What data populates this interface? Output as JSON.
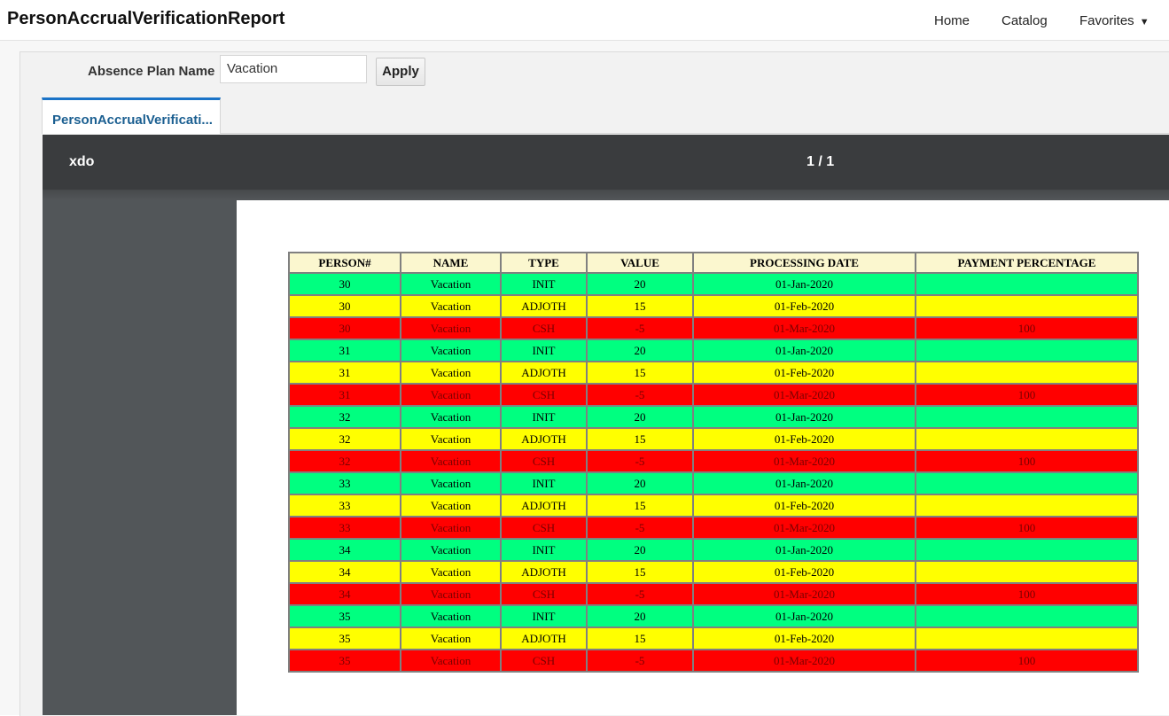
{
  "app": {
    "title": "PersonAccrualVerificationReport"
  },
  "nav": {
    "home": "Home",
    "catalog": "Catalog",
    "favorites": "Favorites"
  },
  "params": {
    "label": "Absence Plan Name",
    "value": "Vacation",
    "apply": "Apply"
  },
  "tab": {
    "label": "PersonAccrualVerificati..."
  },
  "viewer": {
    "name": "xdo",
    "pages": "1 / 1"
  },
  "colors": {
    "init": "#00ff80",
    "adjoth": "#ffff00",
    "csh": "#ff0000",
    "header": "#fbf7cf",
    "tab_accent": "#1a73c7"
  },
  "icons": {
    "favorites_dropdown": "caret-down-icon"
  },
  "table": {
    "headers": [
      "PERSON#",
      "NAME",
      "TYPE",
      "VALUE",
      "PROCESSING DATE",
      "PAYMENT PERCENTAGE"
    ],
    "rows": [
      {
        "person": "30",
        "name": "Vacation",
        "type": "INIT",
        "value": "20",
        "date": "01-Jan-2020",
        "pct": ""
      },
      {
        "person": "30",
        "name": "Vacation",
        "type": "ADJOTH",
        "value": "15",
        "date": "01-Feb-2020",
        "pct": ""
      },
      {
        "person": "30",
        "name": "Vacation",
        "type": "CSH",
        "value": "-5",
        "date": "01-Mar-2020",
        "pct": "100"
      },
      {
        "person": "31",
        "name": "Vacation",
        "type": "INIT",
        "value": "20",
        "date": "01-Jan-2020",
        "pct": ""
      },
      {
        "person": "31",
        "name": "Vacation",
        "type": "ADJOTH",
        "value": "15",
        "date": "01-Feb-2020",
        "pct": ""
      },
      {
        "person": "31",
        "name": "Vacation",
        "type": "CSH",
        "value": "-5",
        "date": "01-Mar-2020",
        "pct": "100"
      },
      {
        "person": "32",
        "name": "Vacation",
        "type": "INIT",
        "value": "20",
        "date": "01-Jan-2020",
        "pct": ""
      },
      {
        "person": "32",
        "name": "Vacation",
        "type": "ADJOTH",
        "value": "15",
        "date": "01-Feb-2020",
        "pct": ""
      },
      {
        "person": "32",
        "name": "Vacation",
        "type": "CSH",
        "value": "-5",
        "date": "01-Mar-2020",
        "pct": "100"
      },
      {
        "person": "33",
        "name": "Vacation",
        "type": "INIT",
        "value": "20",
        "date": "01-Jan-2020",
        "pct": ""
      },
      {
        "person": "33",
        "name": "Vacation",
        "type": "ADJOTH",
        "value": "15",
        "date": "01-Feb-2020",
        "pct": ""
      },
      {
        "person": "33",
        "name": "Vacation",
        "type": "CSH",
        "value": "-5",
        "date": "01-Mar-2020",
        "pct": "100"
      },
      {
        "person": "34",
        "name": "Vacation",
        "type": "INIT",
        "value": "20",
        "date": "01-Jan-2020",
        "pct": ""
      },
      {
        "person": "34",
        "name": "Vacation",
        "type": "ADJOTH",
        "value": "15",
        "date": "01-Feb-2020",
        "pct": ""
      },
      {
        "person": "34",
        "name": "Vacation",
        "type": "CSH",
        "value": "-5",
        "date": "01-Mar-2020",
        "pct": "100"
      },
      {
        "person": "35",
        "name": "Vacation",
        "type": "INIT",
        "value": "20",
        "date": "01-Jan-2020",
        "pct": ""
      },
      {
        "person": "35",
        "name": "Vacation",
        "type": "ADJOTH",
        "value": "15",
        "date": "01-Feb-2020",
        "pct": ""
      },
      {
        "person": "35",
        "name": "Vacation",
        "type": "CSH",
        "value": "-5",
        "date": "01-Mar-2020",
        "pct": "100"
      }
    ]
  }
}
